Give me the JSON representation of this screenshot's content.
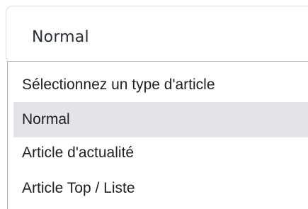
{
  "select": {
    "current_value": "Normal"
  },
  "dropdown": {
    "options": [
      {
        "label": "Sélectionnez un type d'article",
        "selected": false
      },
      {
        "label": "Normal",
        "selected": true
      },
      {
        "label": "Article d'actualité",
        "selected": false
      },
      {
        "label": "Article Top / Liste",
        "selected": false
      }
    ]
  },
  "colors": {
    "highlight_bg": "#e3e3e8",
    "border": "#d9dbe1",
    "text": "#1f1f1f"
  }
}
